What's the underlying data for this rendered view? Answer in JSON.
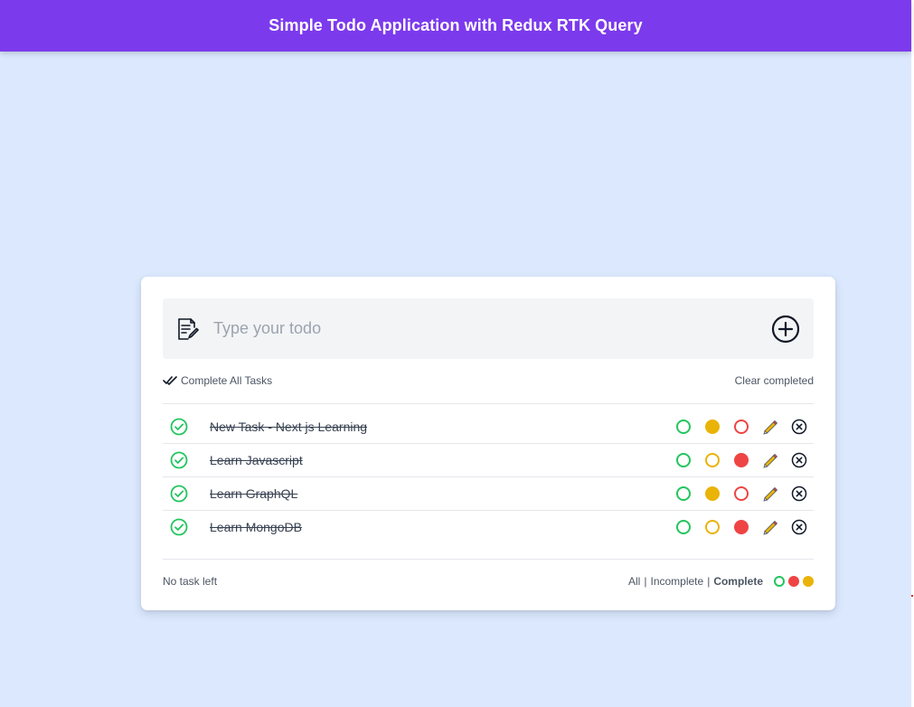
{
  "header": {
    "title": "Simple Todo Application with Redux RTK Query"
  },
  "form": {
    "placeholder": "Type your todo",
    "icon": "note-edit-icon",
    "submit_icon": "plus-circle-icon"
  },
  "toolbar": {
    "complete_all_label": "Complete All Tasks",
    "clear_completed_label": "Clear completed"
  },
  "todos": [
    {
      "text": "New Task - Next js Learning",
      "completed": true,
      "color": "yellow"
    },
    {
      "text": "Learn Javascript",
      "completed": true,
      "color": "red"
    },
    {
      "text": "Learn GraphQL",
      "completed": true,
      "color": "yellow"
    },
    {
      "text": "Learn MongoDB",
      "completed": true,
      "color": "red"
    }
  ],
  "footer": {
    "tasks_left": "No task left",
    "filters": [
      "All",
      "Incomplete",
      "Complete"
    ],
    "active_filter": "Complete",
    "separator": "|"
  },
  "colors": {
    "accent": "#7c3aed",
    "background": "#dbe8fe",
    "green": "#22c55e",
    "yellow": "#eab308",
    "red": "#ef4444"
  }
}
